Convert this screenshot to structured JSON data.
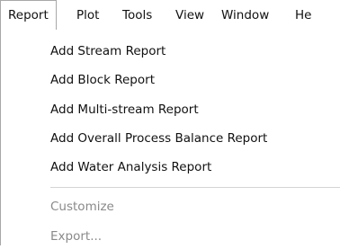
{
  "menubar": {
    "items": [
      {
        "label": "Report"
      },
      {
        "label": "Plot"
      },
      {
        "label": "Tools"
      },
      {
        "label": "View"
      },
      {
        "label": "Window"
      },
      {
        "label": "He"
      }
    ]
  },
  "report_menu": {
    "items": [
      {
        "label": "Add Stream Report"
      },
      {
        "label": "Add Block Report"
      },
      {
        "label": "Add Multi-stream Report"
      },
      {
        "label": "Add Overall Process Balance Report"
      },
      {
        "label": "Add Water Analysis Report"
      }
    ],
    "disabled_items": [
      {
        "label": "Customize"
      },
      {
        "label": "Export..."
      }
    ]
  }
}
